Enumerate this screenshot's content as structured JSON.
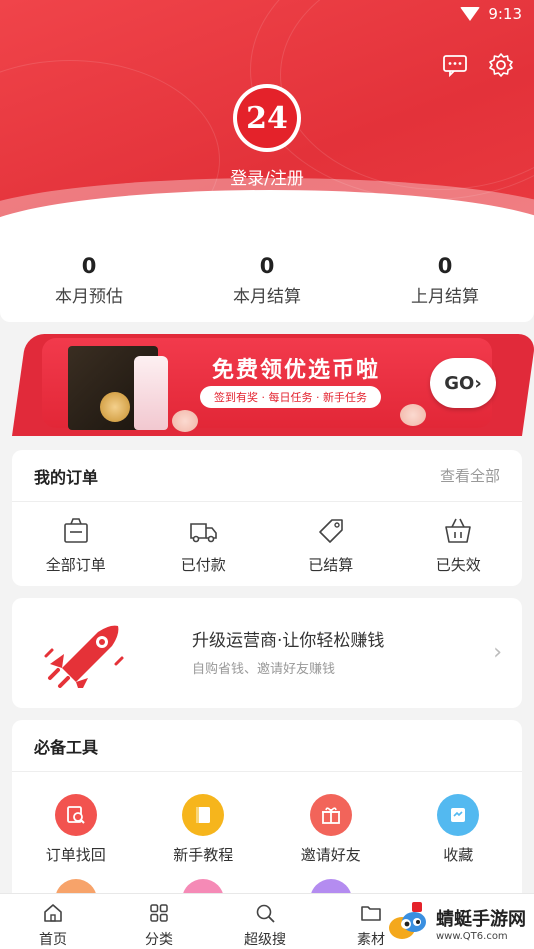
{
  "status_bar": {
    "time": "9:13"
  },
  "header": {
    "logo_text": "24",
    "login_label": "登录/注册",
    "message_icon": "message-icon",
    "settings_icon": "gear-icon"
  },
  "stats": [
    {
      "value": "0",
      "label": "本月预估"
    },
    {
      "value": "0",
      "label": "本月结算"
    },
    {
      "value": "0",
      "label": "上月结算"
    }
  ],
  "banner": {
    "title": "免费领优选币啦",
    "subtitle": "签到有奖 · 每日任务 · 新手任务",
    "go_label": "GO›"
  },
  "orders": {
    "title": "我的订单",
    "more": "查看全部",
    "items": [
      {
        "label": "全部订单",
        "icon": "bag-icon"
      },
      {
        "label": "已付款",
        "icon": "truck-icon"
      },
      {
        "label": "已结算",
        "icon": "tag-icon"
      },
      {
        "label": "已失效",
        "icon": "basket-icon"
      }
    ]
  },
  "promo": {
    "title": "升级运营商·让你轻松赚钱",
    "subtitle": "自购省钱、邀请好友赚钱"
  },
  "tools": {
    "title": "必备工具",
    "items": [
      {
        "label": "订单找回",
        "icon": "search-order-icon",
        "color": "#f2534f"
      },
      {
        "label": "新手教程",
        "icon": "book-icon",
        "color": "#f6b51c"
      },
      {
        "label": "邀请好友",
        "icon": "gift-icon",
        "color": "#f2645a"
      },
      {
        "label": "收藏",
        "icon": "favorite-icon",
        "color": "#53b9f0"
      }
    ],
    "row2_colors": [
      "#f7a36a",
      "#f58ab6",
      "#b48cf0"
    ]
  },
  "tabbar": [
    {
      "label": "首页",
      "icon": "home-icon"
    },
    {
      "label": "分类",
      "icon": "grid-icon"
    },
    {
      "label": "超级搜",
      "icon": "search-icon"
    },
    {
      "label": "素材",
      "icon": "folder-icon"
    }
  ],
  "watermark": {
    "name": "蜻蜓手游网",
    "url": "www.QT6.com"
  }
}
